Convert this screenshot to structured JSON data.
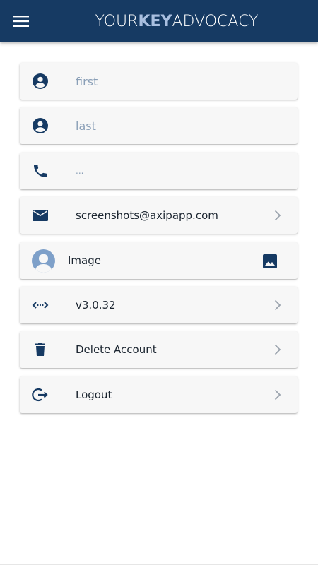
{
  "header": {
    "title_part1": "YOUR",
    "title_part2": "KEY",
    "title_part3": "ADVOCACY",
    "menu_icon": "hamburger-menu-icon",
    "background_color": "#163a63",
    "accent_color": "#a9bfe0"
  },
  "fields": {
    "first": {
      "placeholder": "first",
      "icon": "account-circle-icon"
    },
    "last": {
      "placeholder": "last",
      "icon": "account-circle-icon"
    },
    "phone": {
      "value": "...",
      "icon": "phone-icon"
    },
    "email": {
      "value": "screenshots@axipapp.com",
      "icon": "mail-icon"
    },
    "image": {
      "label": "Image",
      "icon": "image-icon"
    },
    "version": {
      "value": "v3.0.32",
      "icon": "code-icon"
    },
    "delete": {
      "label": "Delete Account",
      "icon": "trash-icon"
    },
    "logout": {
      "label": "Logout",
      "icon": "logout-icon"
    }
  },
  "colors": {
    "icon": "#163a63",
    "card_bg": "#f7f7f7",
    "placeholder": "#8a9fb7",
    "chevron": "#9aa3ad"
  }
}
